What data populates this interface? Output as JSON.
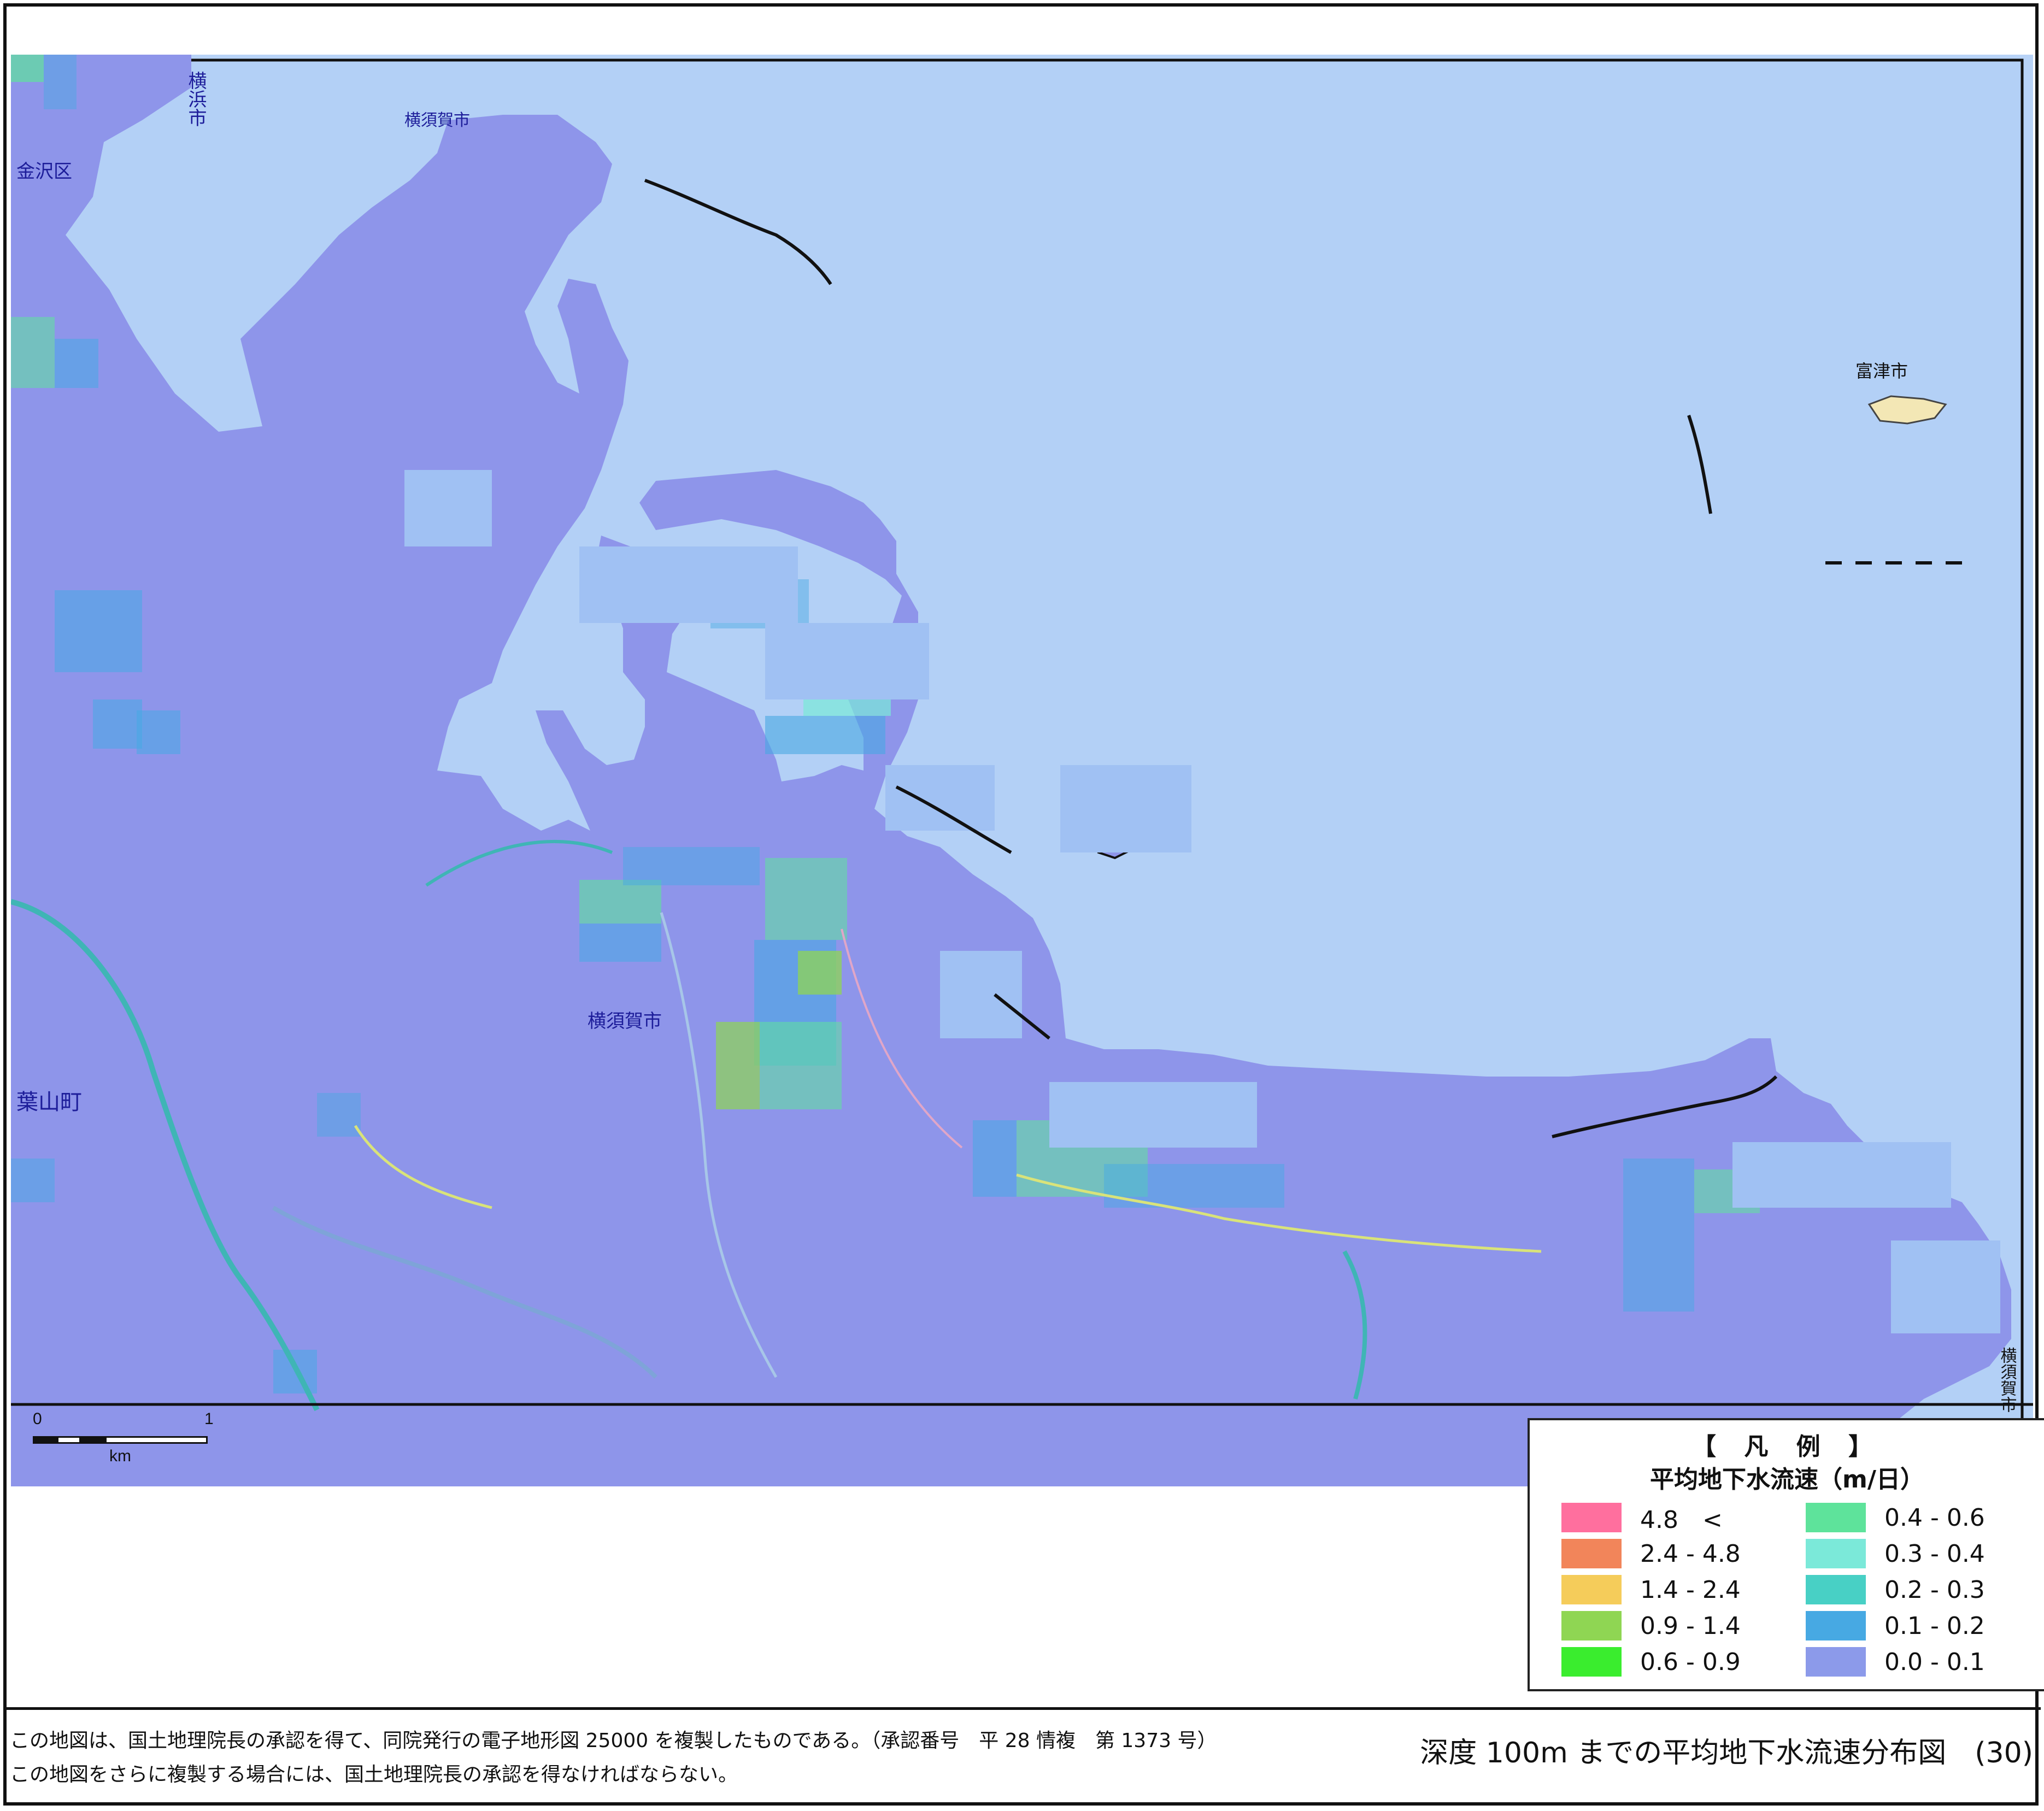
{
  "map": {
    "place_labels": {
      "yokohama": "横浜市",
      "kanazawa": "金沢区",
      "yokosuka_north": "横須賀市",
      "yokosuka_center": "横須賀市",
      "hayama": "葉山町",
      "futtsu": "富津市",
      "yokosuka_east": "横須賀市"
    },
    "scale": {
      "start": "0",
      "end": "1",
      "unit": "km"
    },
    "colors": {
      "sea": "#b8d3f7",
      "land": "#8e95ea",
      "sea_frame": "#a9c8f4",
      "coast": "#111111"
    }
  },
  "legend": {
    "title": "【 凡 例 】",
    "subtitle": "平均地下水流速（m/日）",
    "items": [
      {
        "label": "4.8　<",
        "color": "#ff6f9e"
      },
      {
        "label": "2.4 - 4.8",
        "color": "#f2855a"
      },
      {
        "label": "1.4 - 2.4",
        "color": "#f5cc5a"
      },
      {
        "label": "0.9 - 1.4",
        "color": "#8fd653"
      },
      {
        "label": "0.6 - 0.9",
        "color": "#3aed2e"
      },
      {
        "label": "0.4 - 0.6",
        "color": "#5ee39b"
      },
      {
        "label": "0.3 - 0.4",
        "color": "#7be9d9"
      },
      {
        "label": "0.2 - 0.3",
        "color": "#48d0c5"
      },
      {
        "label": "0.1 - 0.2",
        "color": "#47a9e3"
      },
      {
        "label": "0.0 - 0.1",
        "color": "#8c9aea"
      }
    ]
  },
  "footer": {
    "copyright_line1": "この地図は、国土地理院長の承認を得て、同院発行の電子地形図 25000 を複製したものである。（承認番号　平 28 情複　第 1373 号）",
    "copyright_line2": "この地図をさらに複製する場合には、国土地理院長の承認を得なければならない。",
    "title": "深度 100m までの平均地下水流速分布図　(30)"
  }
}
